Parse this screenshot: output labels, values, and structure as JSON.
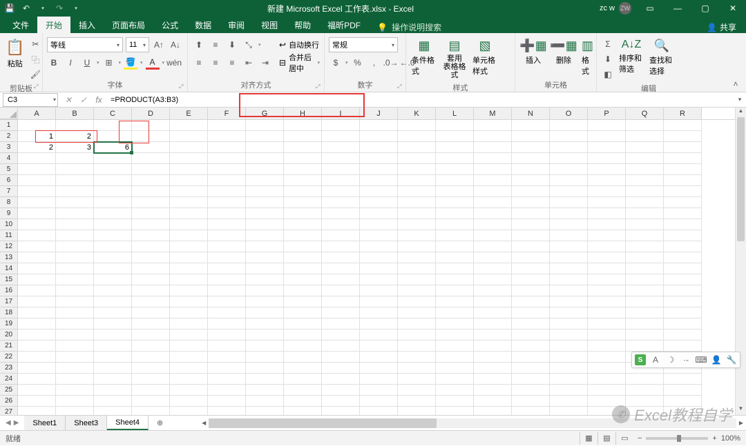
{
  "titlebar": {
    "title": "新建 Microsoft Excel 工作表.xlsx - Excel",
    "user": "zc w",
    "avatar": "ZW"
  },
  "tabs": {
    "file": "文件",
    "active": "开始",
    "items": [
      "开始",
      "插入",
      "页面布局",
      "公式",
      "数据",
      "审阅",
      "视图",
      "帮助",
      "福昕PDF"
    ],
    "tell": "操作说明搜索",
    "share": "共享"
  },
  "ribbon": {
    "clipboard": {
      "label": "剪贴板",
      "paste": "粘贴"
    },
    "font": {
      "label": "字体",
      "name": "等线",
      "size": "11"
    },
    "alignment": {
      "label": "对齐方式",
      "wrap": "自动换行",
      "merge": "合并后居中"
    },
    "number": {
      "label": "数字",
      "format": "常规"
    },
    "styles": {
      "label": "样式",
      "conditional": "条件格式",
      "table": "套用\n表格格式",
      "cell": "单元格样式"
    },
    "cells": {
      "label": "单元格",
      "insert": "插入",
      "delete": "删除",
      "format": "格式"
    },
    "editing": {
      "label": "编辑",
      "sort": "排序和筛选",
      "find": "查找和选择"
    }
  },
  "formula_bar": {
    "name_box": "C3",
    "formula": "=PRODUCT(A3:B3)"
  },
  "columns": [
    "A",
    "B",
    "C",
    "D",
    "E",
    "F",
    "G",
    "H",
    "I",
    "J",
    "K",
    "L",
    "M",
    "N",
    "O",
    "P",
    "Q",
    "R"
  ],
  "rows": [
    1,
    2,
    3,
    4,
    5,
    6,
    7,
    8,
    9,
    10,
    11,
    12,
    13,
    14,
    15,
    16,
    17,
    18,
    19,
    20,
    21,
    22,
    23,
    24,
    25,
    26,
    27
  ],
  "cells": {
    "A2": "1",
    "B2": "2",
    "A3": "2",
    "B3": "3",
    "C3": "6"
  },
  "active_cell": "C3",
  "sheets": {
    "items": [
      "Sheet1",
      "Sheet3",
      "Sheet4"
    ],
    "active": "Sheet4"
  },
  "statusbar": {
    "ready": "就绪",
    "zoom": "100%"
  },
  "watermark": "Excel教程自学"
}
